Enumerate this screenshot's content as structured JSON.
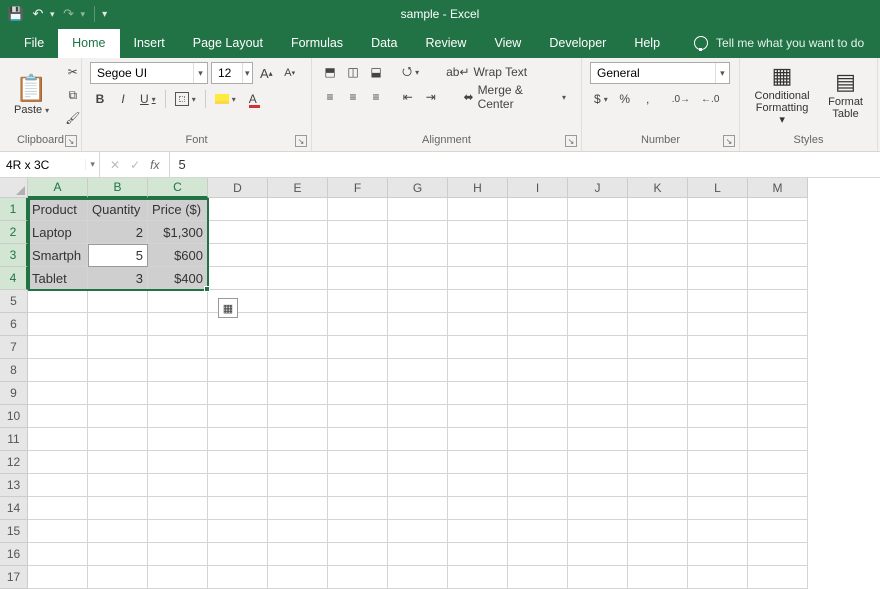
{
  "title": "sample  -  Excel",
  "tabs": [
    "File",
    "Home",
    "Insert",
    "Page Layout",
    "Formulas",
    "Data",
    "Review",
    "View",
    "Developer",
    "Help"
  ],
  "active_tab": 1,
  "tell_me": "Tell me what you want to do",
  "ribbon": {
    "clipboard": {
      "paste": "Paste",
      "label": "Clipboard"
    },
    "font": {
      "name": "Segoe UI",
      "size": "12",
      "label": "Font",
      "bold": "B",
      "italic": "I",
      "underline": "U"
    },
    "alignment": {
      "wrap": "Wrap Text",
      "merge": "Merge & Center",
      "label": "Alignment"
    },
    "number": {
      "format": "General",
      "label": "Number",
      "currency": "$",
      "percent": "%",
      "comma": ",",
      "incdec0": "←.0",
      "incdec1": ".00→"
    },
    "styles": {
      "cond": "Conditional Formatting",
      "table": "Format as Table",
      "label": "Styles"
    }
  },
  "namebox": "4R x 3C",
  "formula": "5",
  "columns": [
    "A",
    "B",
    "C",
    "D",
    "E",
    "F",
    "G",
    "H",
    "I",
    "J",
    "K",
    "L",
    "M"
  ],
  "rows": 17,
  "data": {
    "headers": [
      "Product",
      "Quantity",
      "Price ($)"
    ],
    "r2": [
      "Laptop",
      "2",
      "$1,300"
    ],
    "r3": [
      "Smartph",
      "5",
      "$600"
    ],
    "r4": [
      "Tablet",
      "3",
      "$400"
    ]
  },
  "selection": {
    "top_row": 1,
    "bottom_row": 4,
    "left_col": 1,
    "right_col": 3,
    "active_row": 3,
    "active_col": 2
  }
}
